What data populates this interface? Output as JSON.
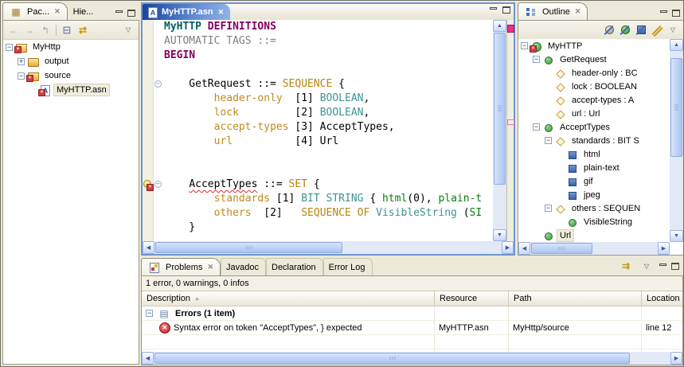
{
  "colors": {
    "chrome": "#ece9d8",
    "border": "#9a9884",
    "editor_border": "#6f94d0",
    "tab_blue_start": "#16459c",
    "tab_blue_end": "#93b3e8",
    "selection_bg": "#f0eddc",
    "error_red": "#e02828",
    "marker_magenta": "#ee2e92",
    "marker_pink": "#e87aa8",
    "scroll_track": "#e3e8f6",
    "scroll_thumb": "#aac4f2",
    "gold": "#c8960c"
  },
  "package_explorer": {
    "tabs": [
      {
        "label": "Pac..."
      },
      {
        "label": "Hie..."
      }
    ],
    "toolbar": [
      "back",
      "forward",
      "up",
      "separator",
      "collapse-all",
      "link-with-editor"
    ],
    "menu_icon": "view-menu",
    "tree": [
      {
        "depth": 0,
        "expander": "minus",
        "icon": "project-error",
        "label": "MyHttp"
      },
      {
        "depth": 1,
        "expander": "plus",
        "icon": "folder",
        "label": "output"
      },
      {
        "depth": 1,
        "expander": "minus",
        "icon": "folder-error",
        "label": "source"
      },
      {
        "depth": 2,
        "expander": null,
        "icon": "asn-file-error",
        "label": "MyHTTP.asn",
        "selected": true
      }
    ]
  },
  "editor": {
    "tab_label": "MyHTTP.asn",
    "syntax_colors": {
      "module": "#00615f",
      "keyword": "#800060",
      "gray": "#7f7f7f",
      "kw2": "#b8860b",
      "field": "#bf8b20",
      "type": "#3f9292",
      "value": "#107a10"
    },
    "lines": [
      {
        "tokens": [
          {
            "t": "MyHTTP",
            "c": "module"
          },
          {
            "t": " ",
            "c": "plain"
          },
          {
            "t": "DEFINITIONS",
            "c": "keyword"
          }
        ]
      },
      {
        "tokens": [
          {
            "t": "AUTOMATIC TAGS ::=",
            "c": "gray"
          }
        ]
      },
      {
        "tokens": [
          {
            "t": "BEGIN",
            "c": "keyword"
          }
        ]
      },
      {
        "tokens": []
      },
      {
        "fold": true,
        "tokens": [
          {
            "t": "    GetRequest ::= ",
            "c": "plain"
          },
          {
            "t": "SEQUENCE",
            "c": "kw2"
          },
          {
            "t": " {",
            "c": "plain"
          }
        ]
      },
      {
        "tokens": [
          {
            "t": "        ",
            "c": "plain"
          },
          {
            "t": "header-only",
            "c": "field"
          },
          {
            "t": "  [1] ",
            "c": "plain"
          },
          {
            "t": "BOOLEAN",
            "c": "type"
          },
          {
            "t": ",",
            "c": "plain"
          }
        ]
      },
      {
        "tokens": [
          {
            "t": "        ",
            "c": "plain"
          },
          {
            "t": "lock",
            "c": "field"
          },
          {
            "t": "         [2] ",
            "c": "plain"
          },
          {
            "t": "BOOLEAN",
            "c": "type"
          },
          {
            "t": ",",
            "c": "plain"
          }
        ]
      },
      {
        "tokens": [
          {
            "t": "        ",
            "c": "plain"
          },
          {
            "t": "accept-types",
            "c": "field"
          },
          {
            "t": " [3] AcceptTypes,",
            "c": "plain"
          }
        ]
      },
      {
        "tokens": [
          {
            "t": "        ",
            "c": "plain"
          },
          {
            "t": "url",
            "c": "field"
          },
          {
            "t": "          [4] Url",
            "c": "plain"
          }
        ]
      },
      {
        "tokens": []
      },
      {
        "tokens": []
      },
      {
        "fold": true,
        "marker": "error",
        "tokens": [
          {
            "t": "    ",
            "c": "plain"
          },
          {
            "t": "AcceptTypes",
            "c": "errtok"
          },
          {
            "t": " ::= ",
            "c": "plain"
          },
          {
            "t": "SET",
            "c": "kw2"
          },
          {
            "t": " {",
            "c": "plain"
          }
        ]
      },
      {
        "tokens": [
          {
            "t": "        ",
            "c": "plain"
          },
          {
            "t": "standards",
            "c": "field"
          },
          {
            "t": " [1] ",
            "c": "plain"
          },
          {
            "t": "BIT STRING",
            "c": "type"
          },
          {
            "t": " { ",
            "c": "plain"
          },
          {
            "t": "html",
            "c": "value"
          },
          {
            "t": "(0), ",
            "c": "plain"
          },
          {
            "t": "plain-t",
            "c": "value"
          }
        ]
      },
      {
        "tokens": [
          {
            "t": "        ",
            "c": "plain"
          },
          {
            "t": "others",
            "c": "field"
          },
          {
            "t": "  [2]   ",
            "c": "plain"
          },
          {
            "t": "SEQUENCE OF",
            "c": "kw2"
          },
          {
            "t": " ",
            "c": "plain"
          },
          {
            "t": "VisibleString",
            "c": "type"
          },
          {
            "t": " (",
            "c": "plain"
          },
          {
            "t": "SI",
            "c": "value"
          }
        ]
      },
      {
        "tokens": [
          {
            "t": "    }",
            "c": "plain"
          }
        ]
      }
    ]
  },
  "outline": {
    "tab_label": "Outline",
    "toolbar": [
      "hide-objects",
      "hide-types",
      "hide-values",
      "hide-fields"
    ],
    "menu_icon": "view-menu",
    "items": [
      {
        "depth": 0,
        "expander": "minus",
        "icon": "module-error",
        "label": "MyHTTP"
      },
      {
        "depth": 1,
        "expander": "minus",
        "icon": "type-circle",
        "label": "GetRequest"
      },
      {
        "depth": 2,
        "expander": null,
        "icon": "field-diamond",
        "label": "header-only : BC"
      },
      {
        "depth": 2,
        "expander": null,
        "icon": "field-diamond",
        "label": "lock : BOOLEAN"
      },
      {
        "depth": 2,
        "expander": null,
        "icon": "field-diamond",
        "label": "accept-types : A"
      },
      {
        "depth": 2,
        "expander": null,
        "icon": "field-diamond",
        "label": "url : Url"
      },
      {
        "depth": 1,
        "expander": "minus",
        "icon": "type-circle",
        "label": "AcceptTypes"
      },
      {
        "depth": 2,
        "expander": "minus",
        "icon": "field-diamond",
        "label": "standards : BIT S"
      },
      {
        "depth": 3,
        "expander": null,
        "icon": "named-bit-square",
        "label": "html"
      },
      {
        "depth": 3,
        "expander": null,
        "icon": "named-bit-square",
        "label": "plain-text"
      },
      {
        "depth": 3,
        "expander": null,
        "icon": "named-bit-square",
        "label": "gif"
      },
      {
        "depth": 3,
        "expander": null,
        "icon": "named-bit-square",
        "label": "jpeg"
      },
      {
        "depth": 2,
        "expander": "minus",
        "icon": "field-diamond",
        "label": "others : SEQUEN"
      },
      {
        "depth": 3,
        "expander": null,
        "icon": "type-circle",
        "label": "VisibleString"
      },
      {
        "depth": 1,
        "expander": null,
        "icon": "type-circle",
        "label": "Url",
        "selected": true
      }
    ]
  },
  "problems": {
    "tabs": [
      {
        "label": "Problems"
      },
      {
        "label": "Javadoc"
      },
      {
        "label": "Declaration"
      },
      {
        "label": "Error Log"
      }
    ],
    "summary": "1 error, 0 warnings, 0 infos",
    "columns": [
      "Description",
      "Resource",
      "Path",
      "Location"
    ],
    "group_row": {
      "label": "Errors (1 item)"
    },
    "rows": [
      {
        "description": "Syntax error on token \"AcceptTypes\", } expected",
        "resource": "MyHTTP.asn",
        "path": "MyHttp/source",
        "location": "line 12"
      }
    ]
  }
}
